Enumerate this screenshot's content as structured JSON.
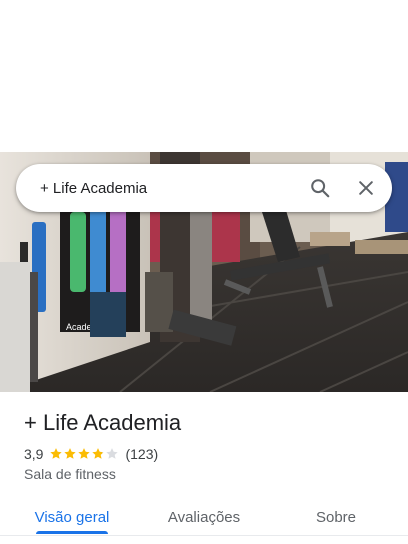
{
  "search": {
    "query": "+ Life Academia",
    "search_icon": "search-icon",
    "close_icon": "close-icon"
  },
  "photo": {
    "wall_text": "Academia",
    "description_icon": "place-photo"
  },
  "place": {
    "title": "+ Life Academia",
    "rating": "3,9",
    "stars_filled": 3.9,
    "stars_total": 5,
    "review_count": "(123)",
    "category": "Sala de fitness"
  },
  "tabs": [
    {
      "label": "Visão geral",
      "active": true
    },
    {
      "label": "Avaliações",
      "active": false
    },
    {
      "label": "Sobre",
      "active": false
    }
  ],
  "colors": {
    "accent": "#1a73e8",
    "star": "#fbbc04",
    "star_empty": "#dadce0"
  }
}
